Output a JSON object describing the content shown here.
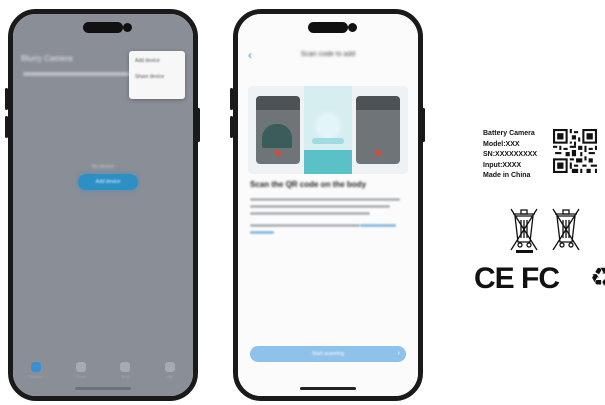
{
  "left_phone": {
    "header_title": "Blurry Camera",
    "dropdown": [
      "Add device",
      "Share device"
    ],
    "empty_state_text": "No device",
    "cta_label": "Add device",
    "tabs": [
      "Devices",
      "Cloud",
      "Shop",
      "Me"
    ]
  },
  "right_phone": {
    "title": "Scan code to add",
    "heading": "Scan the QR code on the body",
    "button_label": "Start scanning"
  },
  "product_label": {
    "lines": [
      "Battery Camera",
      "Model:XXX",
      "SN:XXXXXXXXX",
      "Input:XXXX",
      "Made in China"
    ],
    "marks": "CE FC",
    "icons": [
      "qr-code",
      "crossed-bin",
      "crossed-bin",
      "recycle"
    ]
  },
  "colors": {
    "accent": "#2d8fc6",
    "dim_overlay": "#8a8f97",
    "button_light": "#8fc2ea",
    "water": "#5ac1c8",
    "alert_dot": "#d64a3b"
  }
}
